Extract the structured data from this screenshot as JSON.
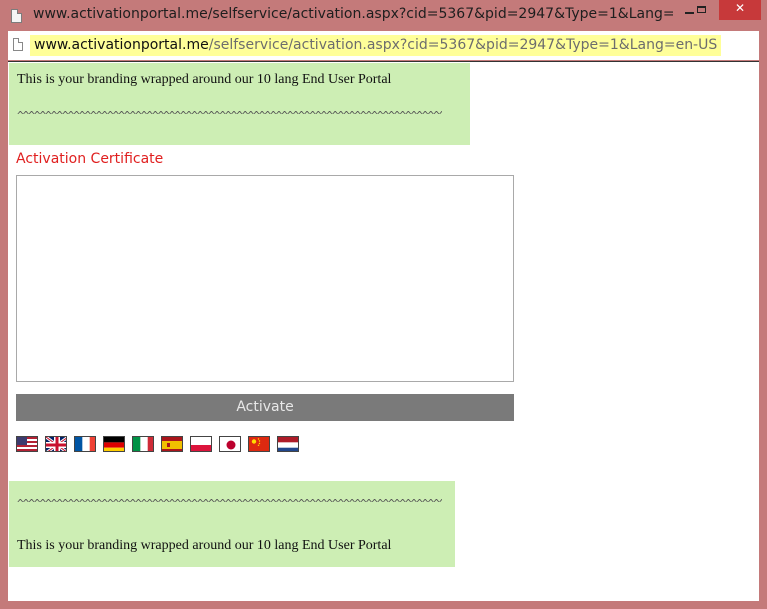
{
  "window": {
    "title": "www.activationportal.me/selfservice/activation.aspx?cid=5367&pid=2947&Type=1&Lang=en...",
    "controls": {
      "minimize": "minimize",
      "maximize": "maximize",
      "close": "close"
    }
  },
  "address_bar": {
    "url_host": "www.activationportal.me",
    "url_path": "/selfservice/activation.aspx?cid=5367&pid=2947&Type=1&Lang=en-US"
  },
  "branding": {
    "text": "This is your branding wrapped around our 10 lang End User Portal",
    "squiggle": "^^^^^^^^^^^^^^^^^^^^^^^^^^^^^^^^^^^^^^^^^^^^^^^^^^^^^^^^^^^^^^^^^^^^^^^^^^^^"
  },
  "form": {
    "cert_label": "Activation Certificate",
    "cert_value": "",
    "activate_label": "Activate"
  },
  "languages": [
    {
      "code": "en-US",
      "icon": "us-flag-icon"
    },
    {
      "code": "en-GB",
      "icon": "uk-flag-icon"
    },
    {
      "code": "fr-FR",
      "icon": "france-flag-icon"
    },
    {
      "code": "de-DE",
      "icon": "germany-flag-icon"
    },
    {
      "code": "it-IT",
      "icon": "italy-flag-icon"
    },
    {
      "code": "es-ES",
      "icon": "spain-flag-icon"
    },
    {
      "code": "pl-PL",
      "icon": "poland-flag-icon"
    },
    {
      "code": "ja-JP",
      "icon": "japan-flag-icon"
    },
    {
      "code": "zh-CN",
      "icon": "china-flag-icon"
    },
    {
      "code": "nl-NL",
      "icon": "netherlands-flag-icon"
    }
  ],
  "colors": {
    "window_frame": "#c47a7a",
    "close_button": "#c7393a",
    "branding_bg": "#cdeeb4",
    "cert_label": "#e02020",
    "activate_bg": "#7a7a7a",
    "url_highlight": "#ffff99"
  }
}
